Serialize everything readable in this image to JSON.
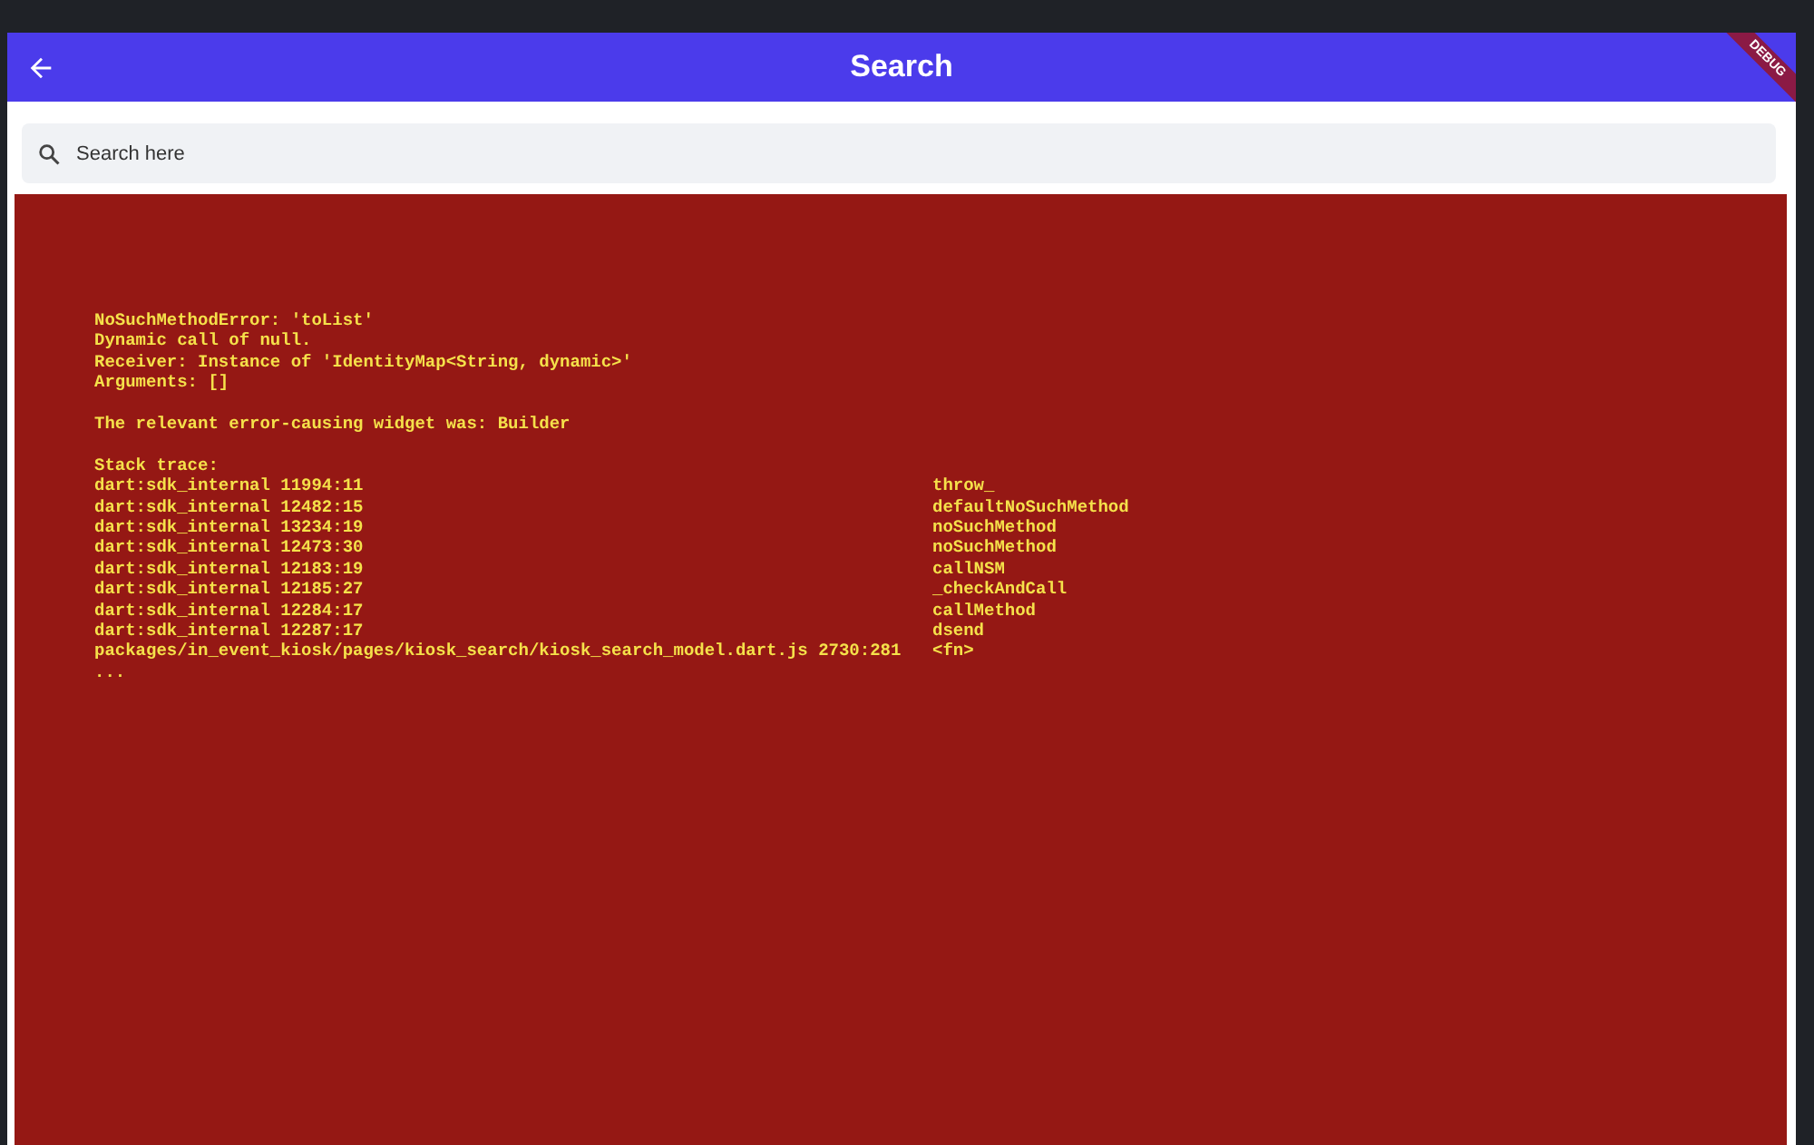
{
  "app_bar": {
    "title": "Search",
    "debug_banner": "DEBUG"
  },
  "search": {
    "placeholder": "Search here"
  },
  "error": {
    "message_lines": [
      "NoSuchMethodError: 'toList'",
      "Dynamic call of null.",
      "Receiver: Instance of 'IdentityMap<String, dynamic>'",
      "Arguments: []"
    ],
    "widget_line": "The relevant error-causing widget was: Builder",
    "stack_heading": "Stack trace:",
    "stack_trace": [
      {
        "location": "dart:sdk_internal 11994:11",
        "function": "throw_"
      },
      {
        "location": "dart:sdk_internal 12482:15",
        "function": "defaultNoSuchMethod"
      },
      {
        "location": "dart:sdk_internal 13234:19",
        "function": "noSuchMethod"
      },
      {
        "location": "dart:sdk_internal 12473:30",
        "function": "noSuchMethod"
      },
      {
        "location": "dart:sdk_internal 12183:19",
        "function": "callNSM"
      },
      {
        "location": "dart:sdk_internal 12185:27",
        "function": "_checkAndCall"
      },
      {
        "location": "dart:sdk_internal 12284:17",
        "function": "callMethod"
      },
      {
        "location": "dart:sdk_internal 12287:17",
        "function": "dsend"
      },
      {
        "location": "packages/in_event_kiosk/pages/kiosk_search/kiosk_search_model.dart.js 2730:281",
        "function": "<fn>"
      }
    ],
    "ellipsis": "..."
  }
}
